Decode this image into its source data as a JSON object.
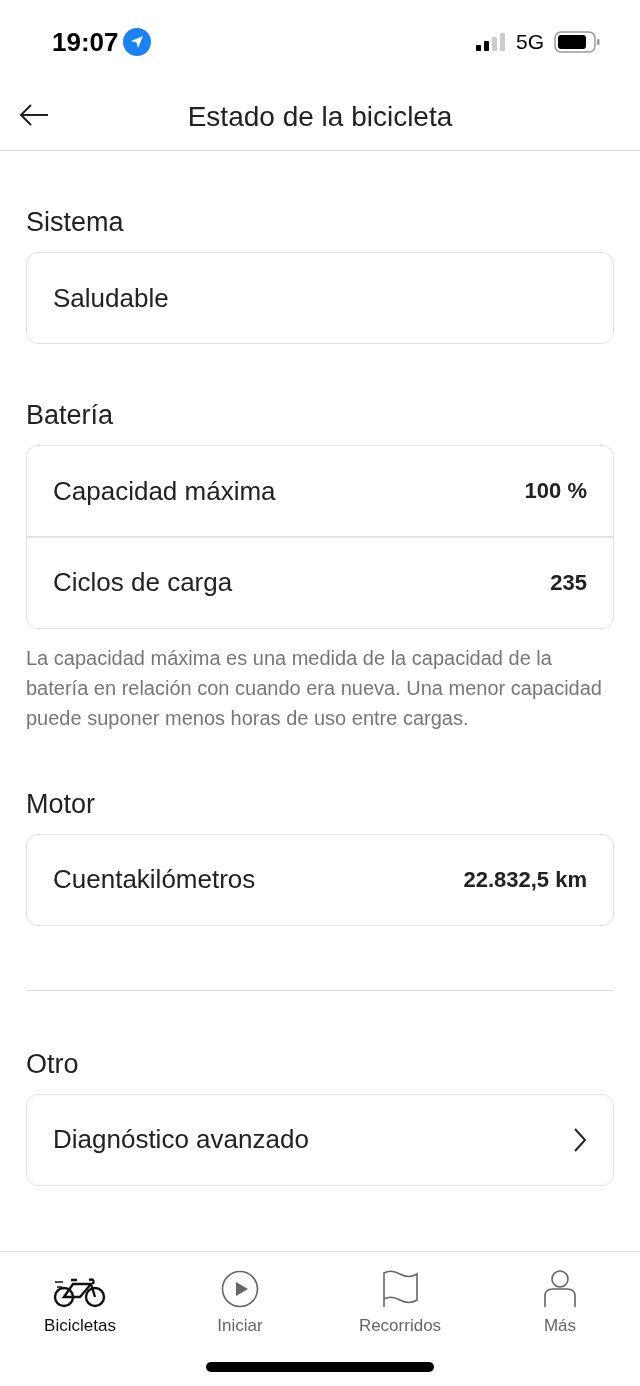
{
  "status_bar": {
    "time": "19:07",
    "network": "5G"
  },
  "header": {
    "title": "Estado de la bicicleta"
  },
  "sections": [
    {
      "title": "Sistema",
      "separated": false,
      "rows": [
        {
          "kind": "plain",
          "label": "Saludable"
        }
      ]
    },
    {
      "title": "Batería",
      "separated": false,
      "rows": [
        {
          "kind": "value",
          "label": "Capacidad máxima",
          "value": "100 %"
        },
        {
          "kind": "value",
          "label": "Ciclos de carga",
          "value": "235"
        }
      ],
      "note": "La capacidad máxima es una medida de la capacidad de la batería en relación con cuando era nueva. Una menor capacidad puede suponer menos horas de uso entre cargas."
    },
    {
      "title": "Motor",
      "separated": false,
      "rows": [
        {
          "kind": "value",
          "label": "Cuentakilómetros",
          "value": "22.832,5 km"
        }
      ]
    },
    {
      "title": "Otro",
      "separated": true,
      "rows": [
        {
          "kind": "link",
          "label": "Diagnóstico avanzado"
        }
      ]
    }
  ],
  "tab_bar": [
    {
      "label": "Bicicletas",
      "selected": true
    },
    {
      "label": "Iniciar",
      "selected": false
    },
    {
      "label": "Recorridos",
      "selected": false
    },
    {
      "label": "Más",
      "selected": false
    }
  ]
}
